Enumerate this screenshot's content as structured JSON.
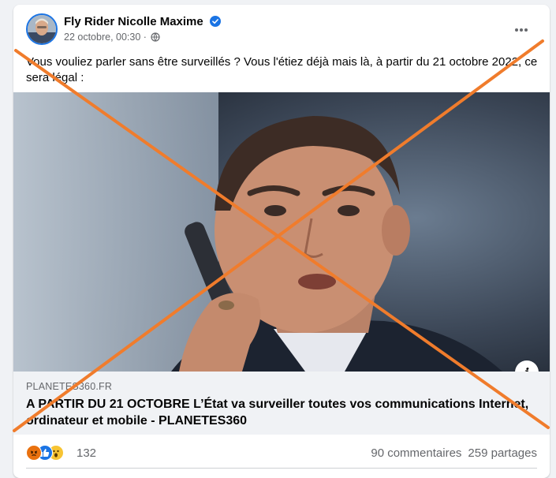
{
  "post": {
    "author": "Fly Rider Nicolle Maxime",
    "timestamp": "22 octobre, 00:30 ·",
    "audience_icon": "globe-icon",
    "verified_icon": "verified-badge-icon",
    "more_icon": "more-options-icon",
    "text": "Vous vouliez parler sans être surveillés ? Vous l'étiez déjà mais là,  à partir du 21 octobre 2022, ce sera légal :"
  },
  "link": {
    "info_label": "i",
    "domain": "PLANETES360.FR",
    "title": "A PARTIR DU 21 OCTOBRE L’État va surveiller toutes vos communications Internet, ordinateur et mobile - PLANETES360"
  },
  "reactions": {
    "icons": [
      "angry-icon",
      "like-icon",
      "wow-icon"
    ],
    "count": "132",
    "comments": "90 commentaires",
    "shares": "259 partages"
  },
  "colors": {
    "brand_blue": "#1b74e4",
    "cross_overlay": "#f07c2c",
    "secondary_text": "#65676b"
  }
}
